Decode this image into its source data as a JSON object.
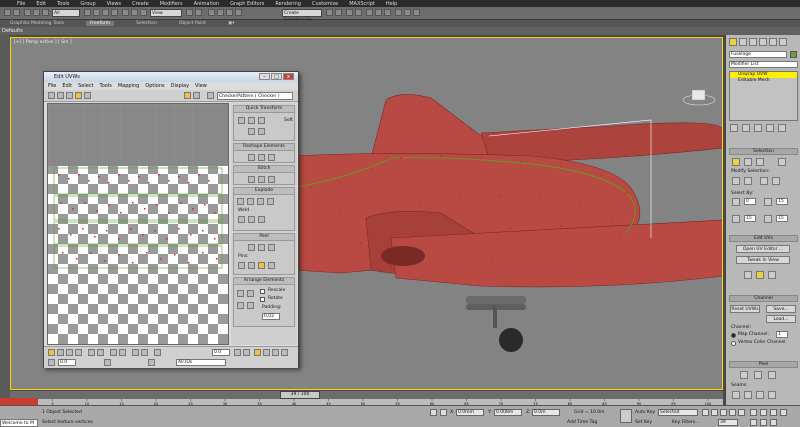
{
  "menubar": [
    "File",
    "Edit",
    "Tools",
    "Group",
    "Views",
    "Create",
    "Modifiers",
    "Animation",
    "Graph Editors",
    "Rendering",
    "Customize",
    "MAXScript",
    "Help"
  ],
  "toolbar": {
    "selection_filter": "All",
    "ref_coord": "View",
    "named_selection": "Create Selection Se"
  },
  "ribbon": {
    "title": "Graphite Modeling Tools",
    "tabs": [
      "Freeform",
      "Selection",
      "Object Paint"
    ]
  },
  "defaults_label": "Defaults",
  "viewport": {
    "label": "[+] [ Persp ective ] [ Sm ]"
  },
  "uvw": {
    "title": "Edit UVWs",
    "min": "–",
    "max": "□",
    "close": "x",
    "menu": [
      "File",
      "Edit",
      "Select",
      "Tools",
      "Mapping",
      "Options",
      "Display",
      "View"
    ],
    "checker_combo": "CheckerPattern  ( Checker )",
    "panels": {
      "quick_transform": "Quick Transform",
      "reshape": "Reshape Elements",
      "stitch": "Stitch",
      "explode": "Explode",
      "weld": "Weld",
      "peel": "Peel",
      "pins": "Pins:",
      "arrange": "Arrange Elements",
      "rescale": "Rescale",
      "rotate": "Rotate",
      "padding_label": "Padding:",
      "padding_value": "0.02",
      "soft": "Soft"
    },
    "bottom": {
      "u_value": "0.0",
      "v_value": "0.0",
      "all_ids": "All IDs"
    }
  },
  "cmdpanel": {
    "object_name": "Fuselage",
    "modifier_list": "Modifier List",
    "stack": [
      "Unwrap UVW",
      "Editable Mesh"
    ],
    "selection_head": "Selection",
    "modify_selection": "Modify Selection:",
    "select_by": "Select By:",
    "select_val1": "0",
    "select_val2": "15",
    "edit_uvs_head": "Edit UVs",
    "open_uv_editor": "Open UV Editor ...",
    "tweak_in_view": "Tweak In View",
    "channel_head": "Channel",
    "reset_uvws": "Reset UVWs",
    "save": "Save...",
    "load": "Load...",
    "channel_label": "Channel:",
    "map_channel": "Map Channel:",
    "map_channel_value": "1",
    "vertex_color": "Vertex Color Channel",
    "peel_head": "Peel",
    "seams": "Seams:"
  },
  "timeslider": "39 / 100",
  "ruler_ticks": [
    "0",
    "5",
    "10",
    "15",
    "20",
    "25",
    "30",
    "35",
    "40",
    "45",
    "50",
    "55",
    "60",
    "65",
    "70",
    "75",
    "80",
    "85",
    "90",
    "95",
    "100"
  ],
  "status": {
    "objects_selected": "1 Object Selected",
    "prompt": "Select texture vertices",
    "x_label": "X:",
    "x_val": "0.0mm",
    "y_label": "Y:",
    "y_val": "0.008m",
    "z_label": "Z:",
    "z_val": "0.0m",
    "grid": "Grid = 10.0m",
    "auto_key": "Auto Key",
    "selected": "Selected",
    "set_key": "Set Key",
    "key_filters": "Key Filters...",
    "add_time_tag": "Add Time Tag",
    "frame": "39"
  },
  "welcome": "Welcome to M",
  "colors": {
    "accent": "#ffd200",
    "model": "#b94a43",
    "selection_red": "#e02020",
    "seam_green": "#5aa02a"
  }
}
